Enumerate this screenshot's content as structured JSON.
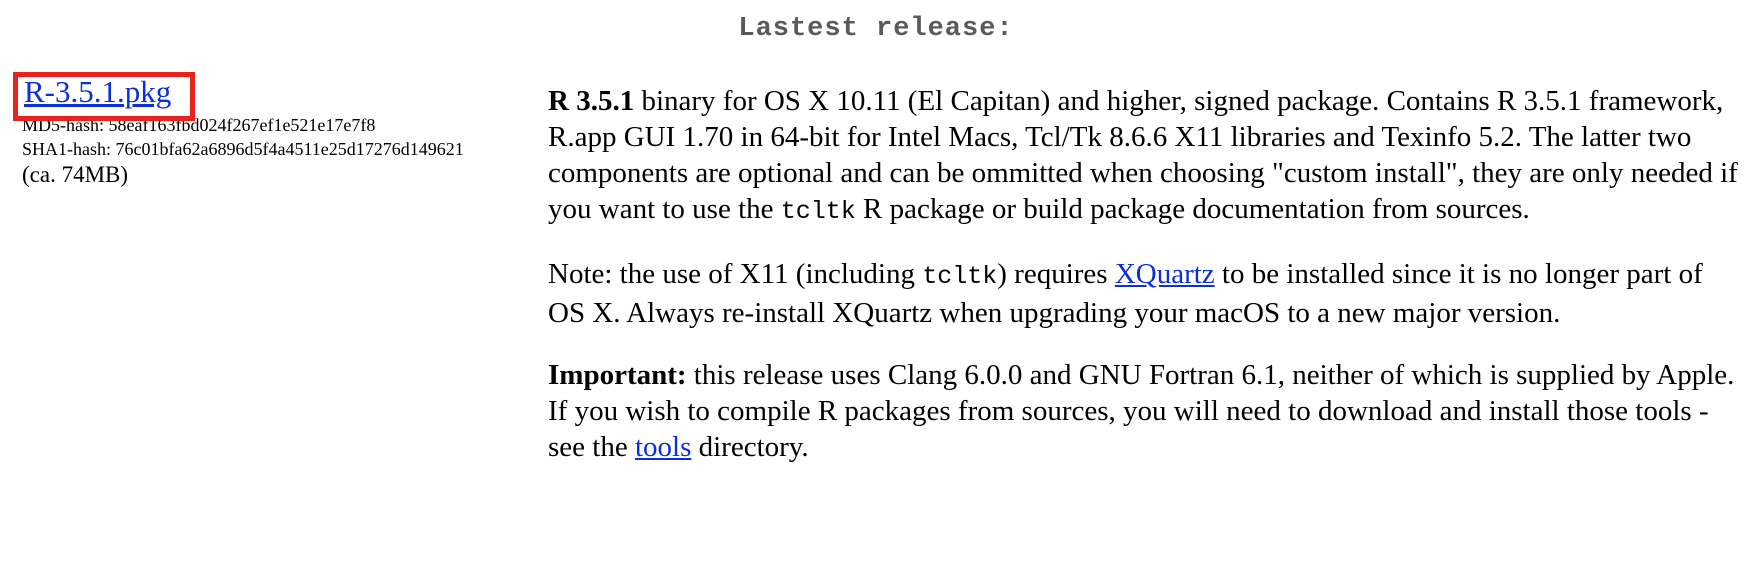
{
  "heading": "Lastest release:",
  "download": {
    "link_label": "R-3.5.1.pkg",
    "md5": "MD5-hash: 58eaf163fbd024f267ef1e521e17e7f8",
    "sha1": "SHA1-hash: 76c01bfa62a6896d5f4a4511e25d17276d149621",
    "size": "(ca. 74MB)"
  },
  "description": {
    "p1_bold": "R 3.5.1",
    "p1_part1": " binary for OS X 10.11 (El Capitan) and higher, signed package. Contains R 3.5.1 framework, R.app GUI 1.70 in 64-bit for Intel Macs, Tcl/Tk 8.6.6 X11 libraries and Texinfo 5.2. The latter two components are optional and can be ommitted when choosing \"custom install\", they are only needed if you want to use the ",
    "p1_code": "tcltk",
    "p1_part2": " R package or build package documentation from sources.",
    "p2_part1": "Note: the use of X11 (including ",
    "p2_code": "tcltk",
    "p2_part2": ") requires ",
    "p2_link": "XQuartz",
    "p2_part3": " to be installed since it is no longer part of OS X. Always re-install XQuartz when upgrading your macOS to a new major version.",
    "p3_bold": "Important:",
    "p3_part1": " this release uses Clang 6.0.0 and GNU Fortran 6.1, neither of which is supplied by Apple. If you wish to compile R packages from sources, you will need to download and install those tools - see the ",
    "p3_link": "tools",
    "p3_part2": " directory."
  },
  "colors": {
    "link": "#0b2fd8",
    "highlight_box": "#e8231d",
    "heading": "#5a5a5a"
  }
}
